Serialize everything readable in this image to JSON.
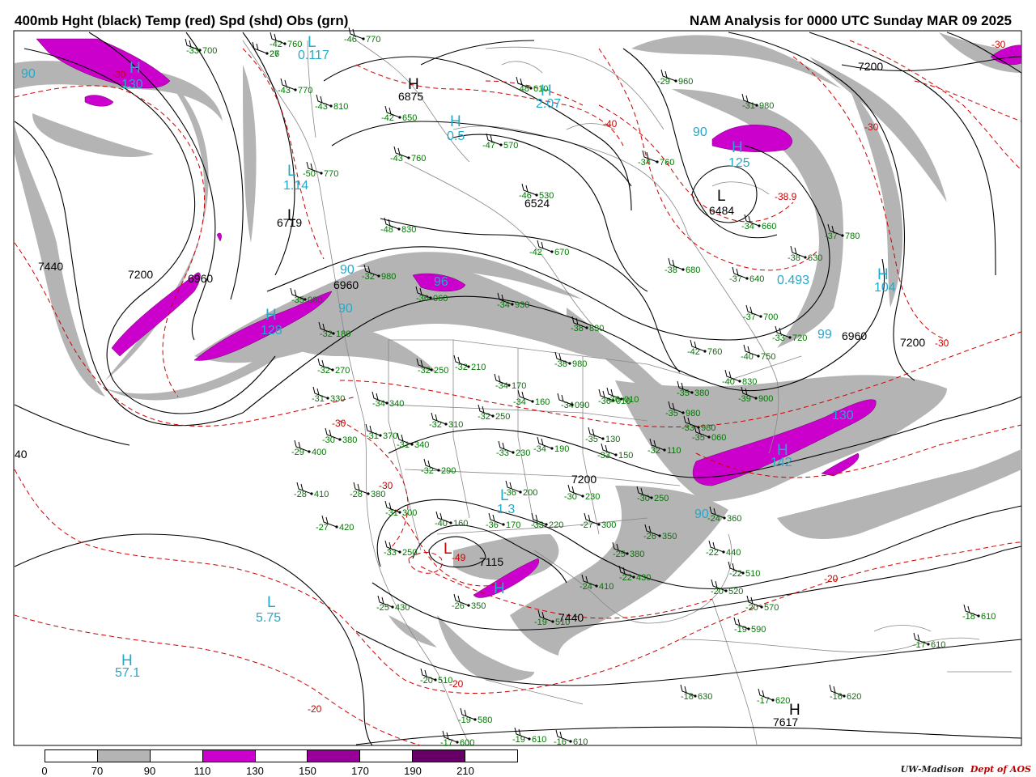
{
  "header": {
    "left_title": "400mb Hght (black) Temp (red) Spd (shd) Obs (grn)",
    "right_title": "NAM Analysis for 0000 UTC Sunday  MAR 09 2025"
  },
  "legend": {
    "labels": [
      "0",
      "70",
      "90",
      "110",
      "130",
      "150",
      "170",
      "190",
      "210"
    ],
    "colors": [
      "#ffffff",
      "#b4b4b4",
      "#ffffff",
      "#cc00cc",
      "#ffffff",
      "#990099",
      "#ffffff",
      "#660066"
    ]
  },
  "credit": {
    "org": "UW-Madison",
    "dept": "Dept of AOS"
  },
  "colors": {
    "height": "#000000",
    "temp": "#cc0000",
    "obs": "#007700",
    "speed_label": "#22aacc",
    "jet70": "#b4b4b4",
    "jet110": "#cc00cc"
  },
  "height_labels": [
    {
      "t": "6875"
    },
    {
      "t": "6719"
    },
    {
      "t": "7440"
    },
    {
      "t": "7200"
    },
    {
      "t": "6960"
    },
    {
      "t": "6960"
    },
    {
      "t": "6524"
    },
    {
      "t": "6484"
    },
    {
      "t": "7200"
    },
    {
      "t": "6960"
    },
    {
      "t": "7200"
    },
    {
      "t": "7200"
    },
    {
      "t": "7115"
    },
    {
      "t": "7440"
    },
    {
      "t": "7617"
    },
    {
      "t": "40"
    }
  ],
  "temp_labels": [
    {
      "t": "-30"
    },
    {
      "t": "-40"
    },
    {
      "t": "-30"
    },
    {
      "t": "-38.9"
    },
    {
      "t": "-30"
    },
    {
      "t": "-30"
    },
    {
      "t": "-30"
    },
    {
      "t": "-20"
    },
    {
      "t": "-20"
    },
    {
      "t": "-20"
    },
    {
      "t": "-49"
    },
    {
      "t": "-30"
    }
  ],
  "speed_labels": [
    {
      "t": "130"
    },
    {
      "t": "90"
    },
    {
      "t": "0.117"
    },
    {
      "t": "2.07"
    },
    {
      "t": "0.5"
    },
    {
      "t": "1.14"
    },
    {
      "t": "128"
    },
    {
      "t": "90"
    },
    {
      "t": "125"
    },
    {
      "t": "90"
    },
    {
      "t": "0.493"
    },
    {
      "t": "104"
    },
    {
      "t": "99"
    },
    {
      "t": "130"
    },
    {
      "t": "142"
    },
    {
      "t": "90"
    },
    {
      "t": "1.3"
    },
    {
      "t": "5.75"
    },
    {
      "t": "57.1"
    },
    {
      "t": "90"
    },
    {
      "t": "96"
    }
  ],
  "pressure_centers": [
    {
      "t": "H"
    },
    {
      "t": "H"
    },
    {
      "t": "L"
    },
    {
      "t": "L"
    },
    {
      "t": "H"
    },
    {
      "t": "H"
    },
    {
      "t": "L"
    },
    {
      "t": "H"
    },
    {
      "t": "H"
    },
    {
      "t": "H"
    },
    {
      "t": "L"
    },
    {
      "t": "L"
    },
    {
      "t": "H"
    },
    {
      "t": "H"
    },
    {
      "t": "L"
    },
    {
      "t": "H"
    },
    {
      "t": "L"
    },
    {
      "t": "H"
    }
  ],
  "obs": [
    {
      "t": "-42"
    },
    {
      "t": "760"
    },
    {
      "t": "-33"
    },
    {
      "t": "700"
    },
    {
      "t": "27"
    },
    {
      "t": "26"
    },
    {
      "t": "-46"
    },
    {
      "t": "770"
    },
    {
      "t": "-43"
    },
    {
      "t": "770"
    },
    {
      "t": "-43"
    },
    {
      "t": "810"
    },
    {
      "t": "-48"
    },
    {
      "t": "610"
    },
    {
      "t": "-42"
    },
    {
      "t": "650"
    },
    {
      "t": "-47"
    },
    {
      "t": "570"
    },
    {
      "t": "-29"
    },
    {
      "t": "960"
    },
    {
      "t": "-31"
    },
    {
      "t": "980"
    },
    {
      "t": "-34"
    },
    {
      "t": "760"
    },
    {
      "t": "-43"
    },
    {
      "t": "760"
    },
    {
      "t": "-50"
    },
    {
      "t": "770"
    },
    {
      "t": "-46"
    },
    {
      "t": "530"
    },
    {
      "t": "-48"
    },
    {
      "t": "830"
    },
    {
      "t": "-42"
    },
    {
      "t": "670"
    },
    {
      "t": "-34"
    },
    {
      "t": "660"
    },
    {
      "t": "-38"
    },
    {
      "t": "630"
    },
    {
      "t": "-37"
    },
    {
      "t": "780"
    },
    {
      "t": "-38"
    },
    {
      "t": "680"
    },
    {
      "t": "-37"
    },
    {
      "t": "640"
    },
    {
      "t": "-37"
    },
    {
      "t": "700"
    },
    {
      "t": "-33"
    },
    {
      "t": "720"
    },
    {
      "t": "-42"
    },
    {
      "t": "760"
    },
    {
      "t": "-40"
    },
    {
      "t": "750"
    },
    {
      "t": "-40"
    },
    {
      "t": "830"
    },
    {
      "t": "-39"
    },
    {
      "t": "900"
    },
    {
      "t": "-32"
    },
    {
      "t": "180"
    },
    {
      "t": "-32"
    },
    {
      "t": "270"
    },
    {
      "t": "-31"
    },
    {
      "t": "330"
    },
    {
      "t": "-34"
    },
    {
      "t": "340"
    },
    {
      "t": "-32"
    },
    {
      "t": "250"
    },
    {
      "t": "-32"
    },
    {
      "t": "210"
    },
    {
      "t": "-34"
    },
    {
      "t": "170"
    },
    {
      "t": "-34"
    },
    {
      "t": "160"
    },
    {
      "t": "-32"
    },
    {
      "t": "310"
    },
    {
      "t": "-32"
    },
    {
      "t": "250"
    },
    {
      "t": "-30"
    },
    {
      "t": "380"
    },
    {
      "t": "-31"
    },
    {
      "t": "370"
    },
    {
      "t": "-31"
    },
    {
      "t": "340"
    },
    {
      "t": "-29"
    },
    {
      "t": "400"
    },
    {
      "t": "-33"
    },
    {
      "t": "230"
    },
    {
      "t": "-34"
    },
    {
      "t": "190"
    },
    {
      "t": "-35"
    },
    {
      "t": "130"
    },
    {
      "t": "-33"
    },
    {
      "t": "150"
    },
    {
      "t": "-28"
    },
    {
      "t": "410"
    },
    {
      "t": "-28"
    },
    {
      "t": "380"
    },
    {
      "t": "-32"
    },
    {
      "t": "290"
    },
    {
      "t": "-36"
    },
    {
      "t": "200"
    },
    {
      "t": "-30"
    },
    {
      "t": "230"
    },
    {
      "t": "-31"
    },
    {
      "t": "300"
    },
    {
      "t": "-27"
    },
    {
      "t": "420"
    },
    {
      "t": "-40"
    },
    {
      "t": "160"
    },
    {
      "t": "-36"
    },
    {
      "t": "170"
    },
    {
      "t": "-33"
    },
    {
      "t": "220"
    },
    {
      "t": "-27"
    },
    {
      "t": "300"
    },
    {
      "t": "-33"
    },
    {
      "t": "250"
    },
    {
      "t": "-25"
    },
    {
      "t": "430"
    },
    {
      "t": "-26"
    },
    {
      "t": "350"
    },
    {
      "t": "-24"
    },
    {
      "t": "410"
    },
    {
      "t": "-22"
    },
    {
      "t": "430"
    },
    {
      "t": "-19"
    },
    {
      "t": "510"
    },
    {
      "t": "-20"
    },
    {
      "t": "510"
    },
    {
      "t": "-19"
    },
    {
      "t": "580"
    },
    {
      "t": "-17"
    },
    {
      "t": "600"
    },
    {
      "t": "-19"
    },
    {
      "t": "610"
    },
    {
      "t": "-16"
    },
    {
      "t": "610"
    },
    {
      "t": "-22"
    },
    {
      "t": "510"
    },
    {
      "t": "-20"
    },
    {
      "t": "520"
    },
    {
      "t": "-20"
    },
    {
      "t": "570"
    },
    {
      "t": "-19"
    },
    {
      "t": "590"
    },
    {
      "t": "-18"
    },
    {
      "t": "630"
    },
    {
      "t": "-17"
    },
    {
      "t": "620"
    },
    {
      "t": "-16"
    },
    {
      "t": "620"
    },
    {
      "t": "-18"
    },
    {
      "t": "610"
    },
    {
      "t": "-17"
    },
    {
      "t": "610"
    },
    {
      "t": "-30"
    },
    {
      "t": "250"
    },
    {
      "t": "-26"
    },
    {
      "t": "350"
    },
    {
      "t": "-25"
    },
    {
      "t": "380"
    },
    {
      "t": "-24"
    },
    {
      "t": "360"
    },
    {
      "t": "-22"
    },
    {
      "t": "440"
    },
    {
      "t": "-35"
    },
    {
      "t": "080"
    },
    {
      "t": "-32"
    },
    {
      "t": "980"
    },
    {
      "t": "-36"
    },
    {
      "t": "060"
    },
    {
      "t": "-34"
    },
    {
      "t": "930"
    },
    {
      "t": "-38"
    },
    {
      "t": "830"
    },
    {
      "t": "-38"
    },
    {
      "t": "980"
    },
    {
      "t": "-36"
    },
    {
      "t": "010"
    },
    {
      "t": "-34"
    },
    {
      "t": "090"
    },
    {
      "t": "-36"
    },
    {
      "t": "010"
    },
    {
      "t": "-35"
    },
    {
      "t": "980"
    },
    {
      "t": "-33"
    },
    {
      "t": "980"
    },
    {
      "t": "-35"
    },
    {
      "t": "060"
    },
    {
      "t": "-32"
    },
    {
      "t": "110"
    },
    {
      "t": "-35"
    },
    {
      "t": "380"
    }
  ]
}
